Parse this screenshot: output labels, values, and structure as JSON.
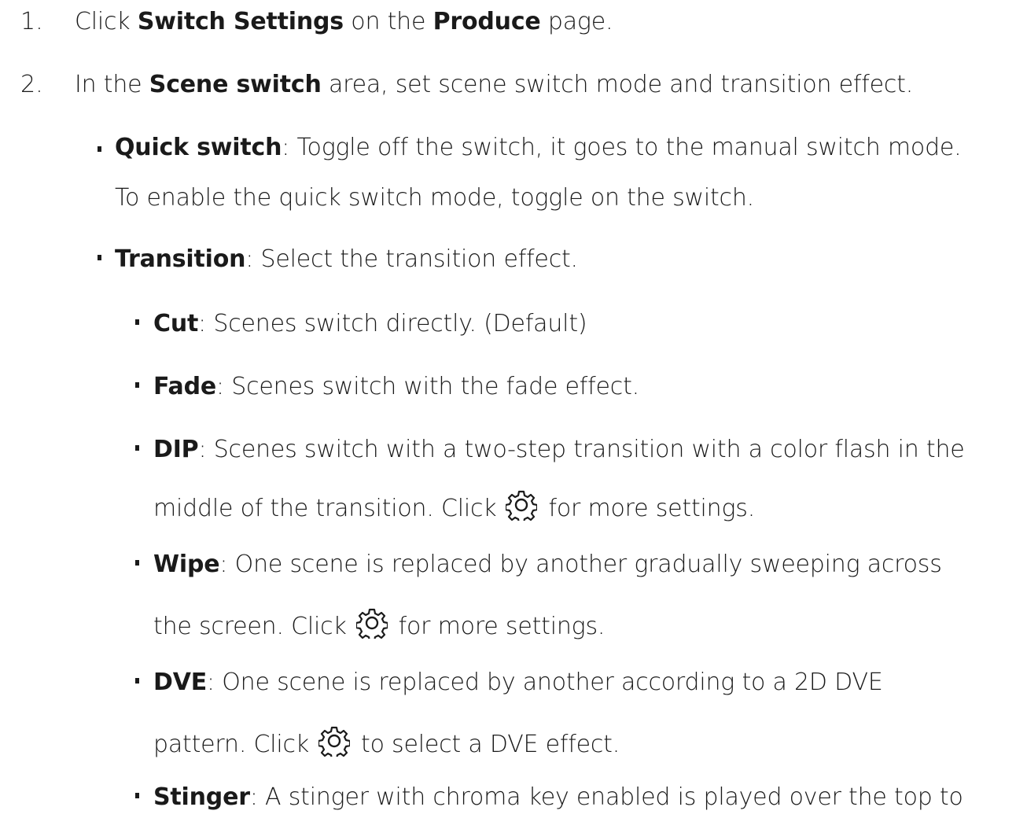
{
  "steps": [
    {
      "number": "1.",
      "parts": {
        "a": "Click ",
        "b": "Switch Settings",
        "c": " on the ",
        "d": "Produce",
        "e": " page."
      }
    },
    {
      "number": "2.",
      "parts": {
        "a": "In the ",
        "b": "Scene switch",
        "c": " area, set scene switch mode and transition effect."
      }
    }
  ],
  "quick_switch": {
    "term": "Quick switch",
    "text1": ": Toggle off the switch, it goes to the manual switch mode.",
    "text2": "To enable the quick switch mode, toggle on the switch."
  },
  "transition": {
    "term": "Transition",
    "text": ": Select the transition effect."
  },
  "options": {
    "cut": {
      "term": "Cut",
      "text": ": Scenes switch directly. (Default)"
    },
    "fade": {
      "term": "Fade",
      "text": ": Scenes switch with the fade effect."
    },
    "dip": {
      "term": "DIP",
      "text1": ": Scenes switch with a two-step transition with a color flash in the",
      "text2a": "middle of the transition. Click",
      "text2b": "for more settings."
    },
    "wipe": {
      "term": "Wipe",
      "text1": ": One scene is replaced by another gradually sweeping across",
      "text2a": "the screen. Click",
      "text2b": "for more settings."
    },
    "dve": {
      "term": "DVE",
      "text1": ": One scene is replaced by another according to a 2D DVE",
      "text2a": "pattern. Click",
      "text2b": "to select a DVE effect."
    },
    "stinger": {
      "term": "Stinger",
      "text1": ": A stinger with chroma key enabled is played over the top to"
    }
  },
  "icons": {
    "settings": "gear-icon"
  },
  "colors": {
    "text": "#1a1a1a",
    "background": "#ffffff"
  }
}
